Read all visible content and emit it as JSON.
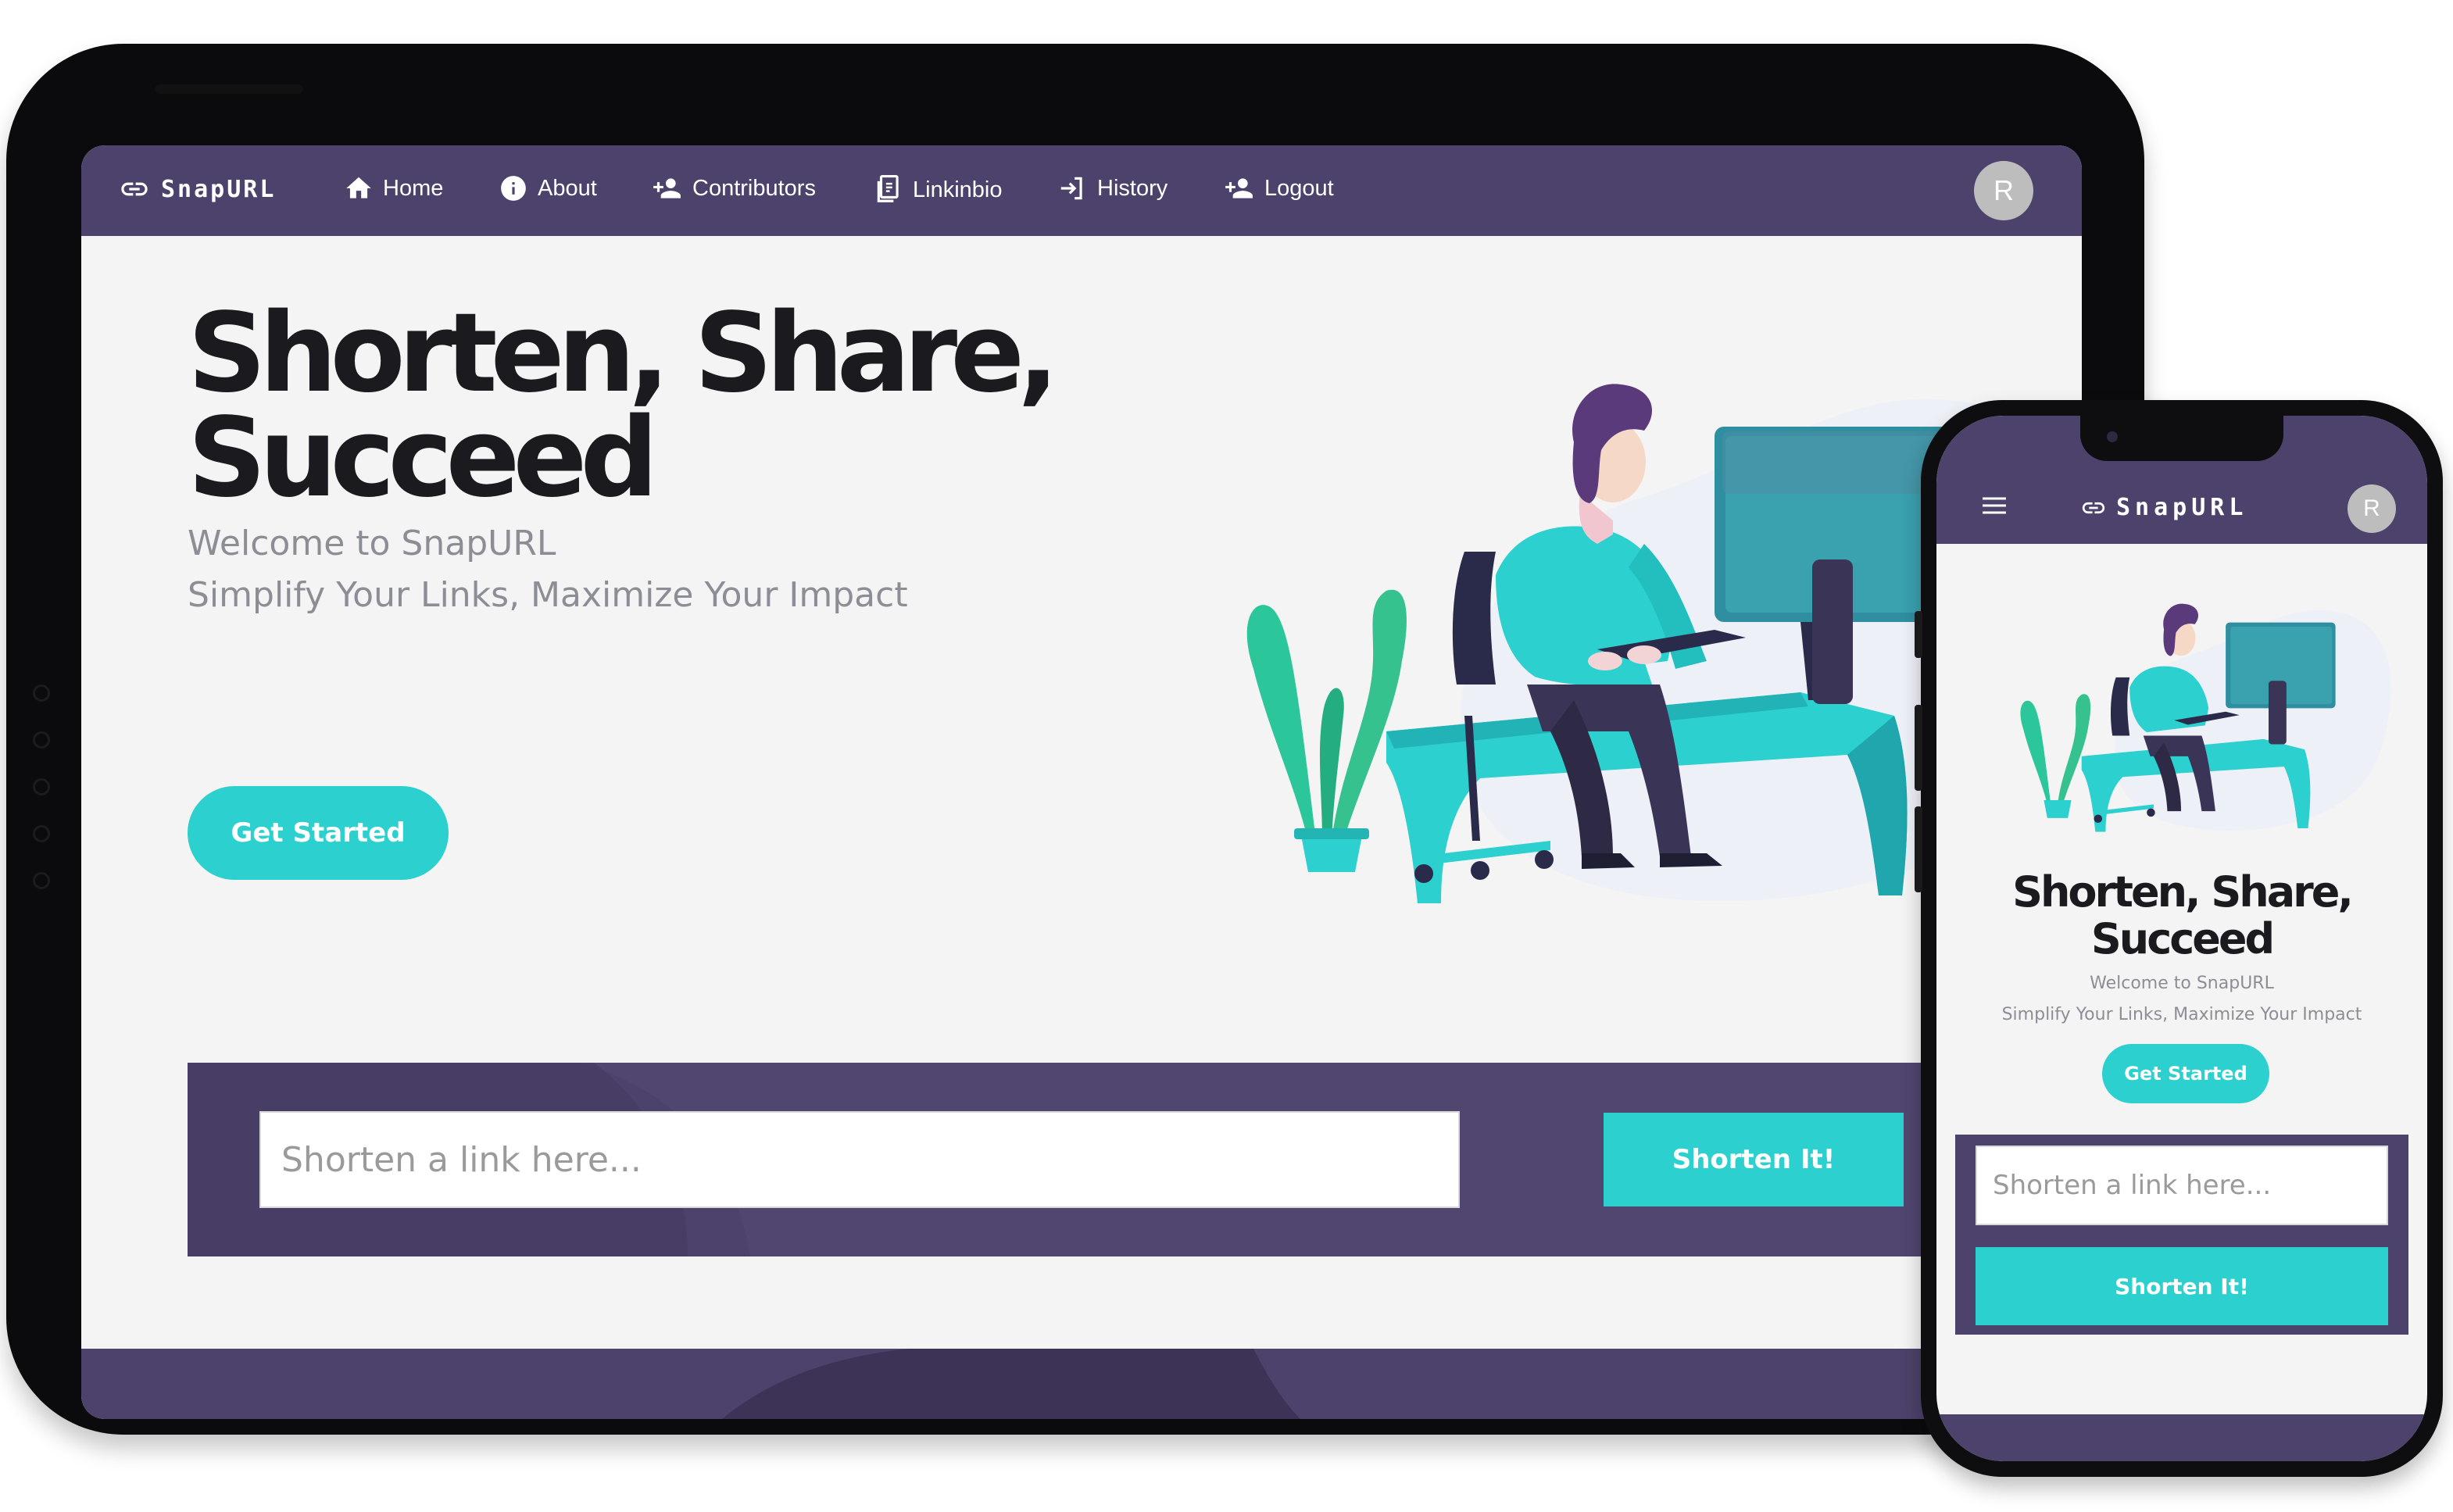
{
  "brand": {
    "name": "SnapURL",
    "icon": "link-icon"
  },
  "nav": {
    "items": [
      {
        "label": "Home",
        "icon": "home-icon"
      },
      {
        "label": "About",
        "icon": "info-icon"
      },
      {
        "label": "Contributors",
        "icon": "add-person-icon"
      },
      {
        "label": "Linkinbio",
        "icon": "document-icon"
      },
      {
        "label": "History",
        "icon": "login-arrow-icon"
      },
      {
        "label": "Logout",
        "icon": "add-person-icon"
      }
    ],
    "avatar_initial": "R",
    "menu_icon": "hamburger-icon"
  },
  "hero": {
    "headline": "Shorten, Share, Succeed",
    "subtitle_1": "Welcome to SnapURL",
    "subtitle_2": "Simplify Your Links, Maximize Your Impact",
    "cta_label": "Get Started"
  },
  "shortener": {
    "placeholder": "Shorten a link here...",
    "button_label": "Shorten It!"
  },
  "colors": {
    "primary_purple": "#4d426b",
    "accent_teal": "#2bd0cf",
    "background": "#f4f4f4",
    "heading": "#1b1b1f",
    "subtext": "#8d8d95"
  }
}
